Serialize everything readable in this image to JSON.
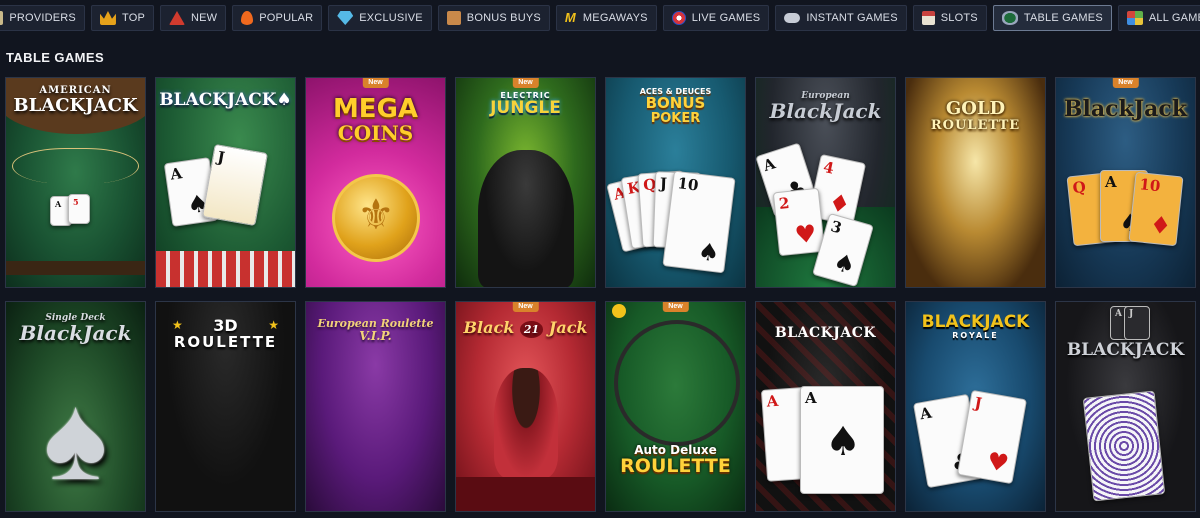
{
  "nav": {
    "items": [
      {
        "label": "PROVIDERS",
        "icon": "providers-icon",
        "color": "#c9b98a",
        "active": false
      },
      {
        "label": "TOP",
        "icon": "crown-icon",
        "color": "#e6a21a",
        "active": false
      },
      {
        "label": "NEW",
        "icon": "new-icon",
        "color": "#d13b2e",
        "active": false
      },
      {
        "label": "POPULAR",
        "icon": "flame-icon",
        "color": "#f0691e",
        "active": false
      },
      {
        "label": "EXCLUSIVE",
        "icon": "diamond-icon",
        "color": "#55b9e6",
        "active": false
      },
      {
        "label": "BONUS BUYS",
        "icon": "gift-icon",
        "color": "#c9894a",
        "active": false
      },
      {
        "label": "MEGAWAYS",
        "icon": "megaways-icon",
        "color": "#f2c21b",
        "active": false
      },
      {
        "label": "LIVE GAMES",
        "icon": "chip-icon",
        "color": "#d6343b",
        "active": false
      },
      {
        "label": "INSTANT GAMES",
        "icon": "gamepad-icon",
        "color": "#c7ccd6",
        "active": false
      },
      {
        "label": "SLOTS",
        "icon": "slot-machine-icon",
        "color": "#c8423e",
        "active": false
      },
      {
        "label": "TABLE GAMES",
        "icon": "table-games-icon",
        "color": "#9aa7bd",
        "active": true
      },
      {
        "label": "ALL GAMES",
        "icon": "all-games-icon",
        "color": "#61b04a",
        "active": false
      }
    ]
  },
  "section": {
    "title": "TABLE GAMES"
  },
  "badge_label": "New",
  "games": [
    {
      "name_lines": [
        "AMERICAN",
        "BLACKJACK"
      ],
      "new": false,
      "theme": "american-blackjack"
    },
    {
      "name_lines": [
        "BLACKJACK♠"
      ],
      "new": false,
      "theme": "blackjack-green"
    },
    {
      "name_lines": [
        "MEGA",
        "COINS"
      ],
      "new": true,
      "theme": "mega-coins"
    },
    {
      "name_lines": [
        "ELECTRIC",
        "JUNGLE"
      ],
      "new": true,
      "theme": "electric-jungle"
    },
    {
      "name_lines": [
        "ACES & DEUCES",
        "BONUS",
        "POKER"
      ],
      "new": false,
      "theme": "aces-deuces"
    },
    {
      "name_lines": [
        "European",
        "BlackJack"
      ],
      "new": false,
      "theme": "european-blackjack"
    },
    {
      "name_lines": [
        "GOLD",
        "ROULETTE"
      ],
      "new": false,
      "theme": "gold-roulette"
    },
    {
      "name_lines": [
        "BlackJack"
      ],
      "new": true,
      "theme": "blackjack-blue"
    },
    {
      "name_lines": [
        "Single Deck",
        "BlackJack"
      ],
      "new": false,
      "theme": "single-deck"
    },
    {
      "name_lines": [
        "3D",
        "ROULETTE"
      ],
      "new": false,
      "theme": "roulette-3d"
    },
    {
      "name_lines": [
        "European Roulette",
        "V.I.P."
      ],
      "new": false,
      "theme": "euro-roulette-vip"
    },
    {
      "name_lines": [
        "Black",
        "21",
        "Jack"
      ],
      "new": true,
      "theme": "black-21-jack"
    },
    {
      "name_lines": [
        "Auto Deluxe",
        "ROULETTE"
      ],
      "new": true,
      "theme": "auto-deluxe"
    },
    {
      "name_lines": [
        "BLACKJACK"
      ],
      "new": false,
      "theme": "blackjack-black"
    },
    {
      "name_lines": [
        "BLACKJACK",
        "ROYALE"
      ],
      "new": false,
      "theme": "blackjack-royale"
    },
    {
      "name_lines": [
        "BLACKJACK"
      ],
      "new": false,
      "theme": "blackjack-dark"
    }
  ]
}
